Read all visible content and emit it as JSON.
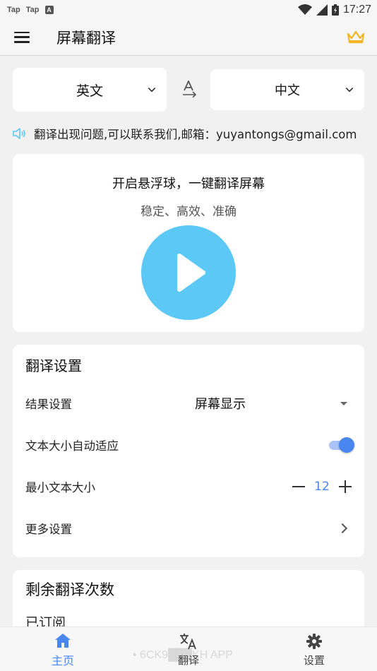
{
  "status_bar": {
    "left_items": [
      "Tap",
      "Tap"
    ],
    "badge": "A",
    "time": "17:27"
  },
  "app_bar": {
    "title": "屏幕翻译"
  },
  "languages": {
    "source": "英文",
    "target": "中文"
  },
  "notice": {
    "text": "翻译出现问题,可以联系我们,邮箱：yuyantongs@gmail.com"
  },
  "float_card": {
    "title": "开启悬浮球，一键翻译屏幕",
    "subtitle": "稳定、高效、准确"
  },
  "settings": {
    "title": "翻译设置",
    "result_label": "结果设置",
    "result_value": "屏幕显示",
    "auto_size_label": "文本大小自动适应",
    "auto_size_enabled": true,
    "min_size_label": "最小文本大小",
    "min_size_value": "12",
    "more_label": "更多设置"
  },
  "count_card": {
    "title": "剩余翻译次数",
    "status": "已订阅"
  },
  "bottom_nav": {
    "items": [
      {
        "label": "主页",
        "icon": "home-icon",
        "active": true
      },
      {
        "label": "翻译",
        "icon": "translate-icon",
        "active": false
      },
      {
        "label": "设置",
        "icon": "gear-icon",
        "active": false
      }
    ],
    "watermark": "• 6CK9███KH APP"
  },
  "colors": {
    "accent": "#4a86f0",
    "play": "#5bc8f5",
    "crown": "#f3b523"
  }
}
